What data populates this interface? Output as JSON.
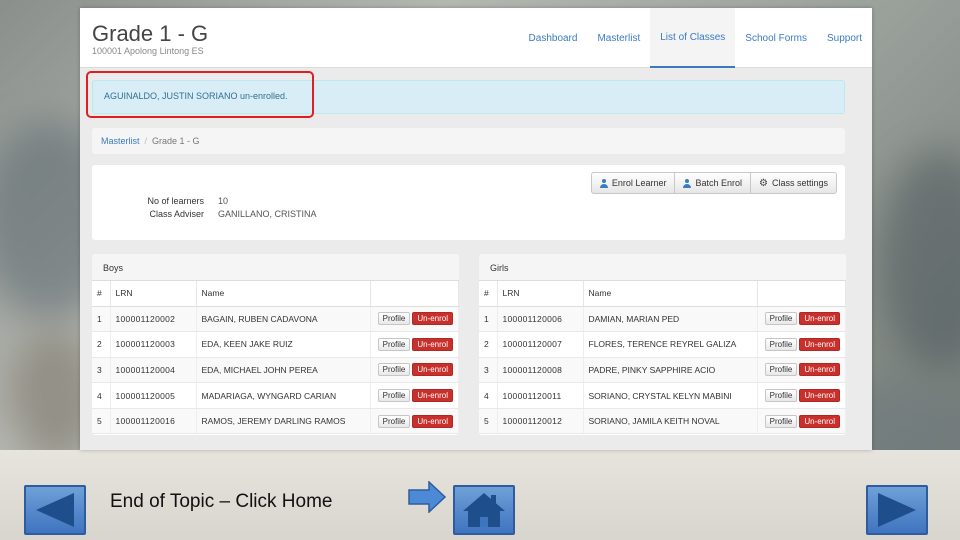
{
  "app": {
    "title": "Grade 1 - G",
    "subtitle": "100001 Apolong Lintong ES"
  },
  "nav": [
    "Dashboard",
    "Masterlist",
    "List of Classes",
    "School Forms",
    "Support"
  ],
  "nav_active": "List of Classes",
  "alert": "AGUINALDO, JUSTIN SORIANO un-enrolled.",
  "breadcrumb": {
    "link": "Masterlist",
    "separator": "/",
    "current": "Grade 1 - G"
  },
  "info": {
    "learners_label": "No of learners",
    "learners_value": "10",
    "adviser_label": "Class Adviser",
    "adviser_value": "GANILLANO, CRISTINA"
  },
  "actions": {
    "enrol_learner": "Enrol Learner",
    "batch_enrol": "Batch Enrol",
    "class_settings": "Class settings"
  },
  "columns": {
    "num": "#",
    "lrn": "LRN",
    "name": "Name"
  },
  "row_buttons": {
    "profile": "Profile",
    "unenrol": "Un-enrol"
  },
  "boys": {
    "title": "Boys",
    "rows": [
      {
        "num": "1",
        "lrn": "100001120002",
        "name": "BAGAIN, RUBEN CADAVONA"
      },
      {
        "num": "2",
        "lrn": "100001120003",
        "name": "EDA, KEEN JAKE RUIZ"
      },
      {
        "num": "3",
        "lrn": "100001120004",
        "name": "EDA, MICHAEL JOHN PEREA"
      },
      {
        "num": "4",
        "lrn": "100001120005",
        "name": "MADARIAGA, WYNGARD CARIAN"
      },
      {
        "num": "5",
        "lrn": "100001120016",
        "name": "RAMOS, JEREMY DARLING RAMOS"
      }
    ]
  },
  "girls": {
    "title": "Girls",
    "rows": [
      {
        "num": "1",
        "lrn": "100001120006",
        "name": "DAMIAN, MARIAN PED"
      },
      {
        "num": "2",
        "lrn": "100001120007",
        "name": "FLORES, TERENCE REYREL GALIZA"
      },
      {
        "num": "3",
        "lrn": "100001120008",
        "name": "PADRE, PINKY SAPPHIRE ACIO"
      },
      {
        "num": "4",
        "lrn": "100001120011",
        "name": "SORIANO, CRYSTAL KELYN MABINI"
      },
      {
        "num": "5",
        "lrn": "100001120012",
        "name": "SORIANO, JAMILA KEITH NOVAL"
      }
    ]
  },
  "slide": {
    "caption": "End of Topic – Click Home"
  },
  "colors": {
    "accent": "#3a7bbf",
    "alert_bg": "#d9edf7",
    "danger": "#c9302c",
    "highlight": "#e02020",
    "nav_button": "#3f74bf"
  }
}
